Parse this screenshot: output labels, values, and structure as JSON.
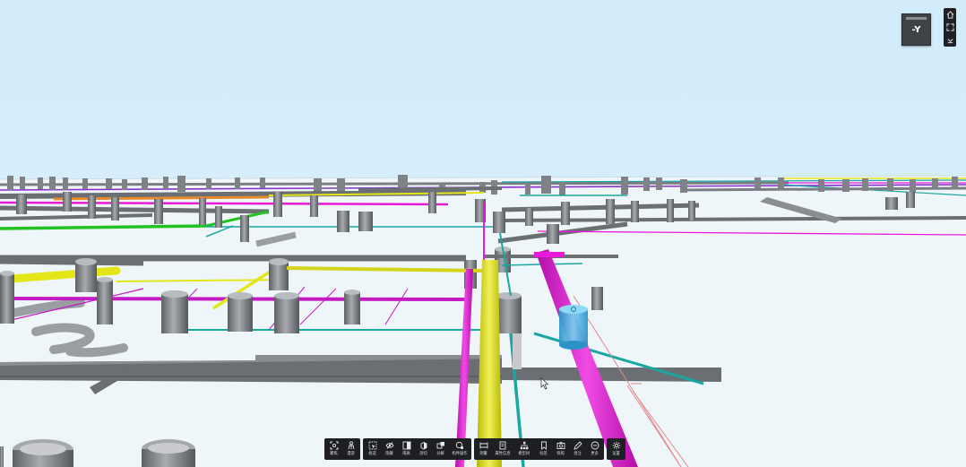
{
  "view_cube": {
    "label": "-Y"
  },
  "right_controls": [
    {
      "icon": "home-icon"
    },
    {
      "icon": "fullscreen-icon"
    },
    {
      "icon": "collapse-icon"
    }
  ],
  "toolbar": {
    "groups": [
      [
        {
          "icon": "fit-view-icon",
          "label": "聚焦"
        },
        {
          "icon": "person-icon",
          "label": "漫游"
        }
      ],
      [
        {
          "icon": "box-select-icon",
          "label": "框选"
        },
        {
          "icon": "eye-hide-icon",
          "label": "隐藏"
        },
        {
          "icon": "isolate-icon",
          "label": "隔离"
        },
        {
          "icon": "section-icon",
          "label": "剖切"
        },
        {
          "icon": "explode-icon",
          "label": "分解"
        },
        {
          "icon": "all-ops-icon",
          "label": "构件操作"
        }
      ],
      [
        {
          "icon": "measure-icon",
          "label": "测量"
        },
        {
          "icon": "properties-icon",
          "label": "属性信息"
        },
        {
          "icon": "model-tree-icon",
          "label": "模型树"
        },
        {
          "icon": "bookmark-icon",
          "label": "标签"
        },
        {
          "icon": "camera-icon",
          "label": "快照"
        },
        {
          "icon": "annotate-icon",
          "label": "批注"
        },
        {
          "icon": "more-icon",
          "label": "更多"
        }
      ],
      [
        {
          "icon": "settings-icon",
          "label": "设置"
        }
      ]
    ]
  },
  "colors": {
    "sky": "#d6eefb",
    "ground": "#eef6fa",
    "pipe_gray": "#6b6e72",
    "pipe_yellow": "#e5e61a",
    "pipe_magenta": "#e81ad8",
    "pipe_teal": "#1aa7a1",
    "pipe_green": "#21c221",
    "pipe_orange": "#e8892b",
    "selected_cyan": "#4ab8e8",
    "toolbar_bg": "#1d1f22"
  }
}
